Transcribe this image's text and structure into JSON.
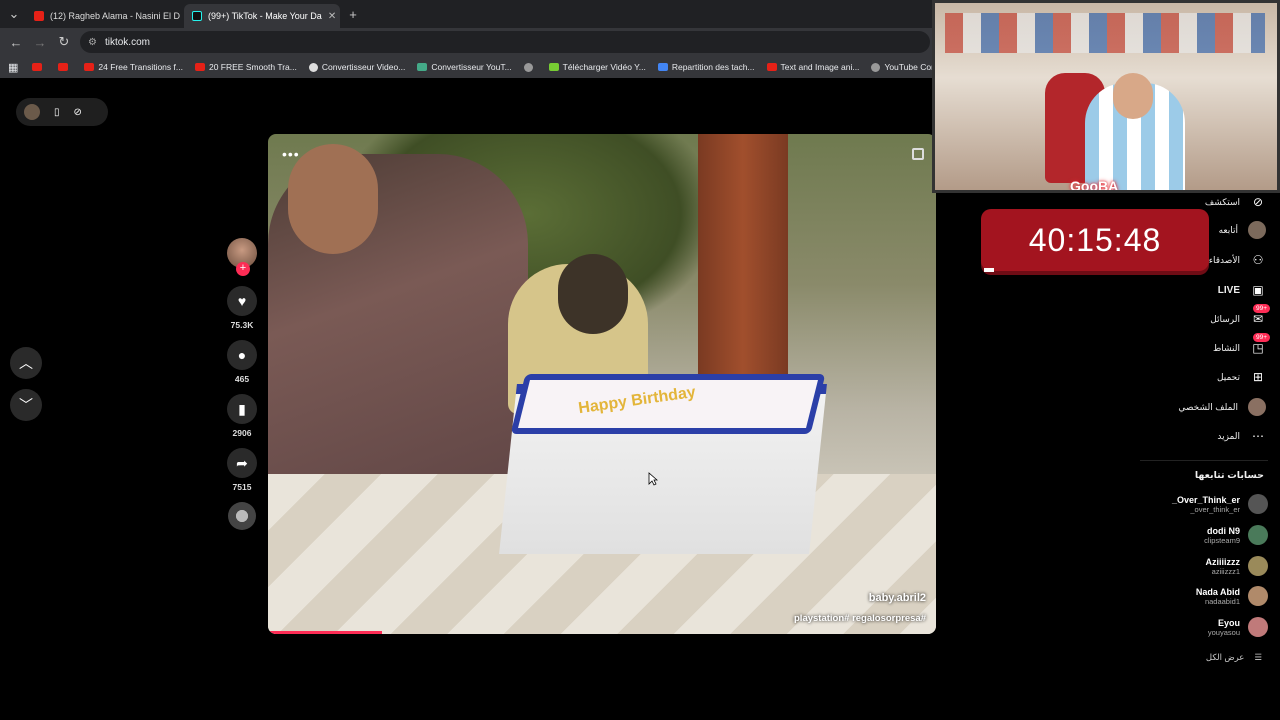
{
  "browser": {
    "tabs": [
      {
        "title": "(12) Ragheb Alama - Nasini El D",
        "active": false
      },
      {
        "title": "(99+) TikTok - Make Your Da",
        "active": true
      }
    ],
    "new_tab": "+",
    "url": "tiktok.com",
    "bookmarks": [
      "",
      "",
      "24 Free Transitions f...",
      "20 FREE Smooth Tra...",
      "Convertisseur Video...",
      "Convertisseur YouT...",
      "",
      "Télécharger Vidéo Y...",
      "Repartition des tach...",
      "Text and Image ani...",
      "YouTube Converter..."
    ]
  },
  "video": {
    "author": "baby.abril2",
    "caption": "playstation# regalosorpresa#",
    "cake_text": "Happy Birthday",
    "progress": 0.17
  },
  "actions": {
    "likes": "75.3K",
    "comments": "465",
    "saves": "2906",
    "shares": "7515"
  },
  "timer": "40:15:48",
  "webcam": {
    "logo": "GooBA"
  },
  "sidebar": {
    "explore": "استكشف",
    "following": "أتابعه",
    "friends": "الأصدقاء",
    "live": "LIVE",
    "messages": "الرسائل",
    "activity": "النشاط",
    "upload": "تحميل",
    "profile": "الملف الشخصي",
    "more": "المزيد",
    "badge_messages": "99+",
    "badge_activity": "99+"
  },
  "following_accounts": {
    "title": "حسابات تتابعها",
    "accounts": [
      {
        "name": "_Over_Think_er",
        "handle": "_over_think_er"
      },
      {
        "name": "dodi N9",
        "handle": "clipsteam9"
      },
      {
        "name": "Aziiiizzz",
        "handle": "aziiizzz1"
      },
      {
        "name": "Nada Abid",
        "handle": "nadaabid1"
      },
      {
        "name": "Eyou",
        "handle": "youyasou"
      }
    ],
    "see_all": "عرض الكل"
  },
  "colors": {
    "accent": "#fe2c55",
    "timer_bg": "#a3141f"
  }
}
